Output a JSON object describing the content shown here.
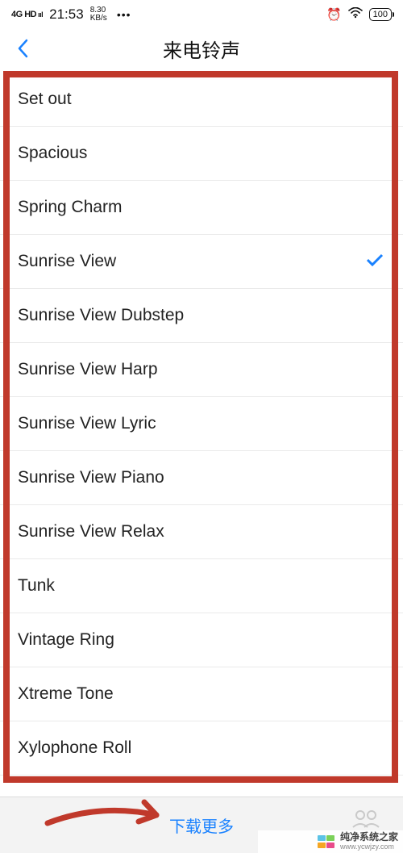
{
  "status": {
    "network": "4G HD",
    "time": "21:53",
    "speed_top": "8.30",
    "speed_bottom": "KB/s",
    "battery": "100"
  },
  "header": {
    "title": "来电铃声"
  },
  "ringtones": [
    {
      "label": "Set out",
      "selected": false
    },
    {
      "label": "Spacious",
      "selected": false
    },
    {
      "label": "Spring Charm",
      "selected": false
    },
    {
      "label": "Sunrise View",
      "selected": true
    },
    {
      "label": "Sunrise View Dubstep",
      "selected": false
    },
    {
      "label": "Sunrise View Harp",
      "selected": false
    },
    {
      "label": "Sunrise View Lyric",
      "selected": false
    },
    {
      "label": "Sunrise View Piano",
      "selected": false
    },
    {
      "label": "Sunrise View Relax",
      "selected": false
    },
    {
      "label": "Tunk",
      "selected": false
    },
    {
      "label": "Vintage Ring",
      "selected": false
    },
    {
      "label": "Xtreme Tone",
      "selected": false
    },
    {
      "label": "Xylophone Roll",
      "selected": false
    }
  ],
  "bottom": {
    "download_more": "下载更多"
  },
  "watermark": {
    "line1": "纯净系统之家",
    "line2": "www.ycwjzy.com"
  }
}
